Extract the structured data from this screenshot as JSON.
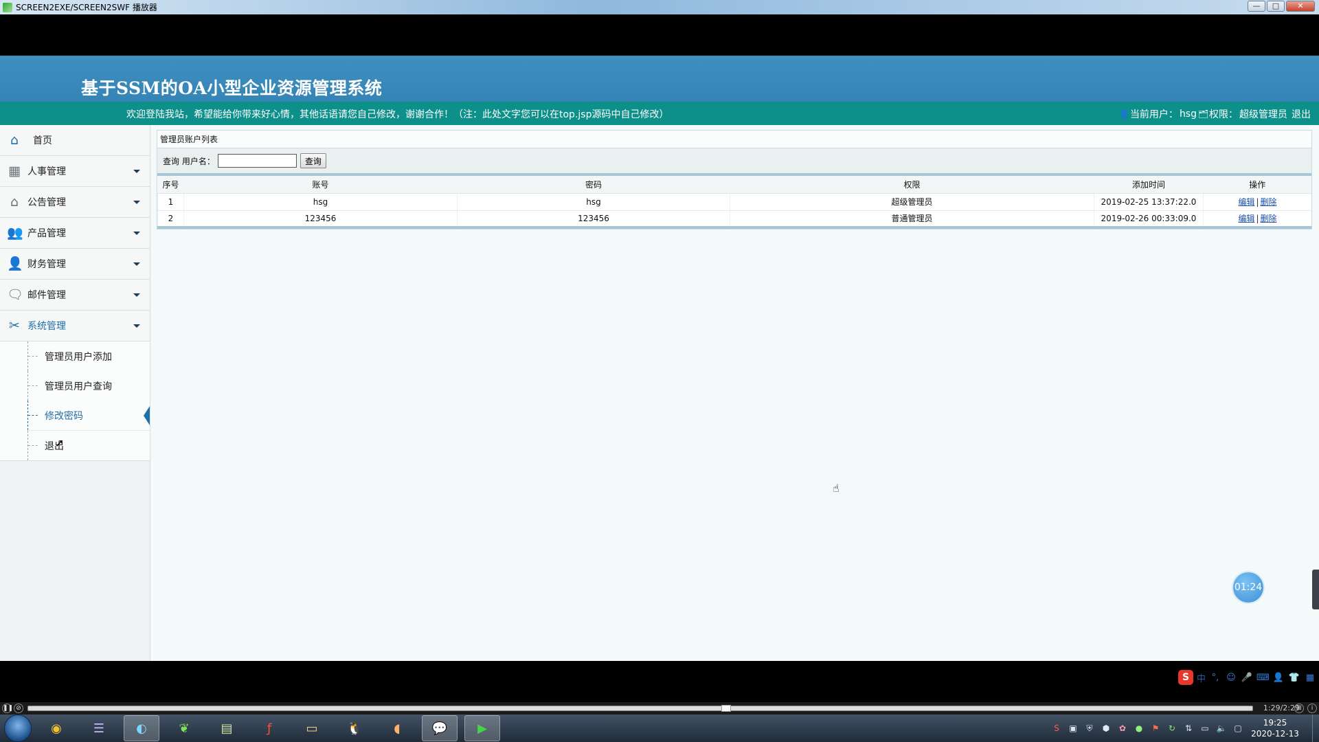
{
  "window": {
    "title": "SCREEN2EXE/SCREEN2SWF 播放器",
    "buttons": {
      "minimize": "—",
      "maximize": "□",
      "close": "✕"
    }
  },
  "header": {
    "system_title": "基于SSM的OA小型企业资源管理系统",
    "welcome": "欢迎登陆我站，希望能给你带来好心情，其他话语请您自己修改，谢谢合作！（注：此处文字您可以在top.jsp源码中自己修改）",
    "current_user_label": "当前用户：",
    "current_user": "hsg",
    "role_label": "权限：",
    "role": "超级管理员",
    "logout": "退出"
  },
  "sidebar": {
    "items": [
      {
        "label": "首页",
        "icon": "home-icon"
      },
      {
        "label": "人事管理",
        "icon": "grid-icon"
      },
      {
        "label": "公告管理",
        "icon": "house-icon"
      },
      {
        "label": "产品管理",
        "icon": "users-icon"
      },
      {
        "label": "财务管理",
        "icon": "person-icon"
      },
      {
        "label": "邮件管理",
        "icon": "chat-icon"
      },
      {
        "label": "系统管理",
        "icon": "tools-icon"
      }
    ],
    "submenu": [
      {
        "label": "管理员用户添加"
      },
      {
        "label": "管理员用户查询"
      },
      {
        "label": "修改密码"
      },
      {
        "label": "退出"
      }
    ]
  },
  "panel": {
    "title": "管理员账户列表",
    "search_label": "查询 用户名：",
    "search_value": "",
    "search_button": "查询"
  },
  "table": {
    "columns": [
      "序号",
      "账号",
      "密码",
      "权限",
      "添加时间",
      "操作"
    ],
    "rows": [
      {
        "index": "1",
        "account": "hsg",
        "password": "hsg",
        "role": "超级管理员",
        "added": "2019-02-25 13:37:22.0",
        "edit": "编辑",
        "delete": "删除"
      },
      {
        "index": "2",
        "account": "123456",
        "password": "123456",
        "role": "普通管理员",
        "added": "2019-02-26 00:33:09.0",
        "edit": "编辑",
        "delete": "删除"
      }
    ],
    "action_separator": "|"
  },
  "overlay": {
    "timer": "01:24"
  },
  "ime": {
    "mode": "中"
  },
  "player": {
    "progress": 0.57,
    "time": "1:29/2:29"
  },
  "taskbar": {
    "clock_time": "19:25",
    "clock_date": "2020-12-13"
  }
}
